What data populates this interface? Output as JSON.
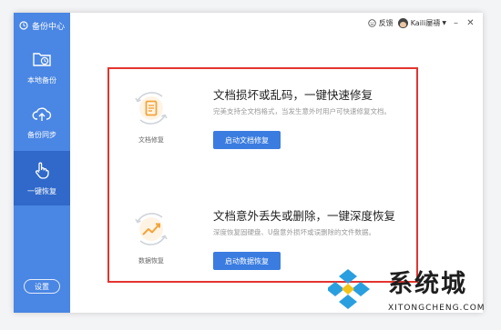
{
  "app": {
    "title": "备份中心"
  },
  "sidebar": {
    "items": [
      {
        "label": "本地备份",
        "icon": "folder-clock-icon"
      },
      {
        "label": "备份同步",
        "icon": "cloud-upload-icon"
      },
      {
        "label": "一键恢复",
        "icon": "hand-pointer-icon",
        "active": true
      }
    ],
    "settings_label": "设置"
  },
  "titlebar": {
    "feedback_label": "反馈",
    "username": "Kaili屡禱",
    "controls": [
      "minimize",
      "close"
    ]
  },
  "features": [
    {
      "caption": "文档修复",
      "title": "文档损坏或乱码，一键快速修复",
      "description": "完美支持全文档格式，当发生意外时用户可快速修复文档。",
      "button_label": "启动文档修复",
      "icon": "document-repair-icon"
    },
    {
      "caption": "数据恢复",
      "title": "文档意外丢失或删除，一键深度恢复",
      "description": "深度恢复固硬盘、U盘意外损坏或误删除的文件数据。",
      "button_label": "启动数据恢复",
      "icon": "data-recovery-icon"
    }
  ],
  "watermark": {
    "text": "系统城",
    "subtext": "XITONGCHENG.COM"
  },
  "colors": {
    "sidebar": "#4a86e3",
    "sidebar_active": "#3069c9",
    "button": "#3a7ce0",
    "highlight_border": "#e3342f",
    "icon_orange": "#f3a33a"
  }
}
